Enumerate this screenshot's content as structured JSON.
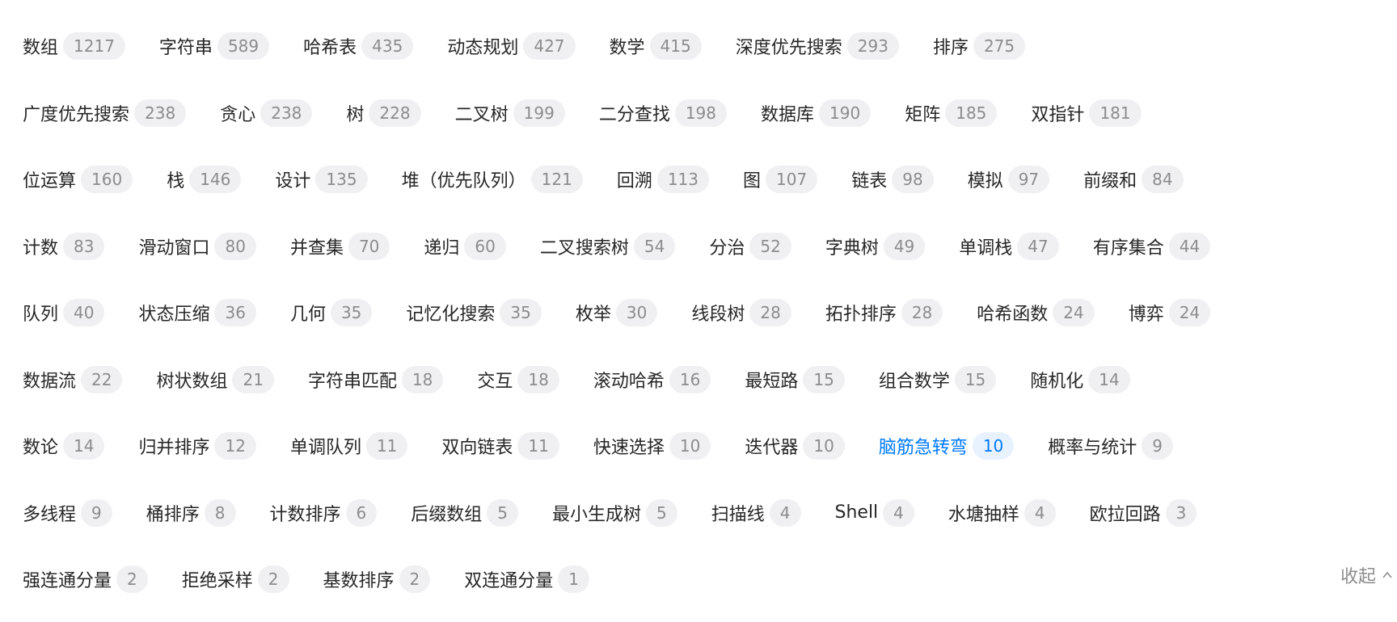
{
  "rows": [
    [
      [
        "数组",
        "1217"
      ],
      [
        "字符串",
        "589"
      ],
      [
        "哈希表",
        "435"
      ],
      [
        "动态规划",
        "427"
      ],
      [
        "数学",
        "415"
      ],
      [
        "深度优先搜索",
        "293"
      ],
      [
        "排序",
        "275"
      ]
    ],
    [
      [
        "广度优先搜索",
        "238"
      ],
      [
        "贪心",
        "238"
      ],
      [
        "树",
        "228"
      ],
      [
        "二叉树",
        "199"
      ],
      [
        "二分查找",
        "198"
      ],
      [
        "数据库",
        "190"
      ],
      [
        "矩阵",
        "185"
      ],
      [
        "双指针",
        "181"
      ]
    ],
    [
      [
        "位运算",
        "160"
      ],
      [
        "栈",
        "146"
      ],
      [
        "设计",
        "135"
      ],
      [
        "堆（优先队列）",
        "121"
      ],
      [
        "回溯",
        "113"
      ],
      [
        "图",
        "107"
      ],
      [
        "链表",
        "98"
      ],
      [
        "模拟",
        "97"
      ],
      [
        "前缀和",
        "84"
      ]
    ],
    [
      [
        "计数",
        "83"
      ],
      [
        "滑动窗口",
        "80"
      ],
      [
        "并查集",
        "70"
      ],
      [
        "递归",
        "60"
      ],
      [
        "二叉搜索树",
        "54"
      ],
      [
        "分治",
        "52"
      ],
      [
        "字典树",
        "49"
      ],
      [
        "单调栈",
        "47"
      ],
      [
        "有序集合",
        "44"
      ]
    ],
    [
      [
        "队列",
        "40"
      ],
      [
        "状态压缩",
        "36"
      ],
      [
        "几何",
        "35"
      ],
      [
        "记忆化搜索",
        "35"
      ],
      [
        "枚举",
        "30"
      ],
      [
        "线段树",
        "28"
      ],
      [
        "拓扑排序",
        "28"
      ],
      [
        "哈希函数",
        "24"
      ],
      [
        "博弈",
        "24"
      ]
    ],
    [
      [
        "数据流",
        "22"
      ],
      [
        "树状数组",
        "21"
      ],
      [
        "字符串匹配",
        "18"
      ],
      [
        "交互",
        "18"
      ],
      [
        "滚动哈希",
        "16"
      ],
      [
        "最短路",
        "15"
      ],
      [
        "组合数学",
        "15"
      ],
      [
        "随机化",
        "14"
      ]
    ],
    [
      [
        "数论",
        "14"
      ],
      [
        "归并排序",
        "12"
      ],
      [
        "单调队列",
        "11"
      ],
      [
        "双向链表",
        "11"
      ],
      [
        "快速选择",
        "10"
      ],
      [
        "迭代器",
        "10"
      ],
      [
        "脑筋急转弯",
        "10"
      ],
      [
        "概率与统计",
        "9"
      ]
    ],
    [
      [
        "多线程",
        "9"
      ],
      [
        "桶排序",
        "8"
      ],
      [
        "计数排序",
        "6"
      ],
      [
        "后缀数组",
        "5"
      ],
      [
        "最小生成树",
        "5"
      ],
      [
        "扫描线",
        "4"
      ],
      [
        "Shell",
        "4"
      ],
      [
        "水塘抽样",
        "4"
      ],
      [
        "欧拉回路",
        "3"
      ]
    ],
    [
      [
        "强连通分量",
        "2"
      ],
      [
        "拒绝采样",
        "2"
      ],
      [
        "基数排序",
        "2"
      ],
      [
        "双连通分量",
        "1"
      ]
    ]
  ],
  "active_tag": "脑筋急转弯",
  "collapse": {
    "label": "收起",
    "icon": "chevron-up-icon"
  },
  "colors": {
    "accent": "#007aff",
    "text": "#262626",
    "badge_bg": "#f0f0f2",
    "muted": "#8c8c8c"
  }
}
